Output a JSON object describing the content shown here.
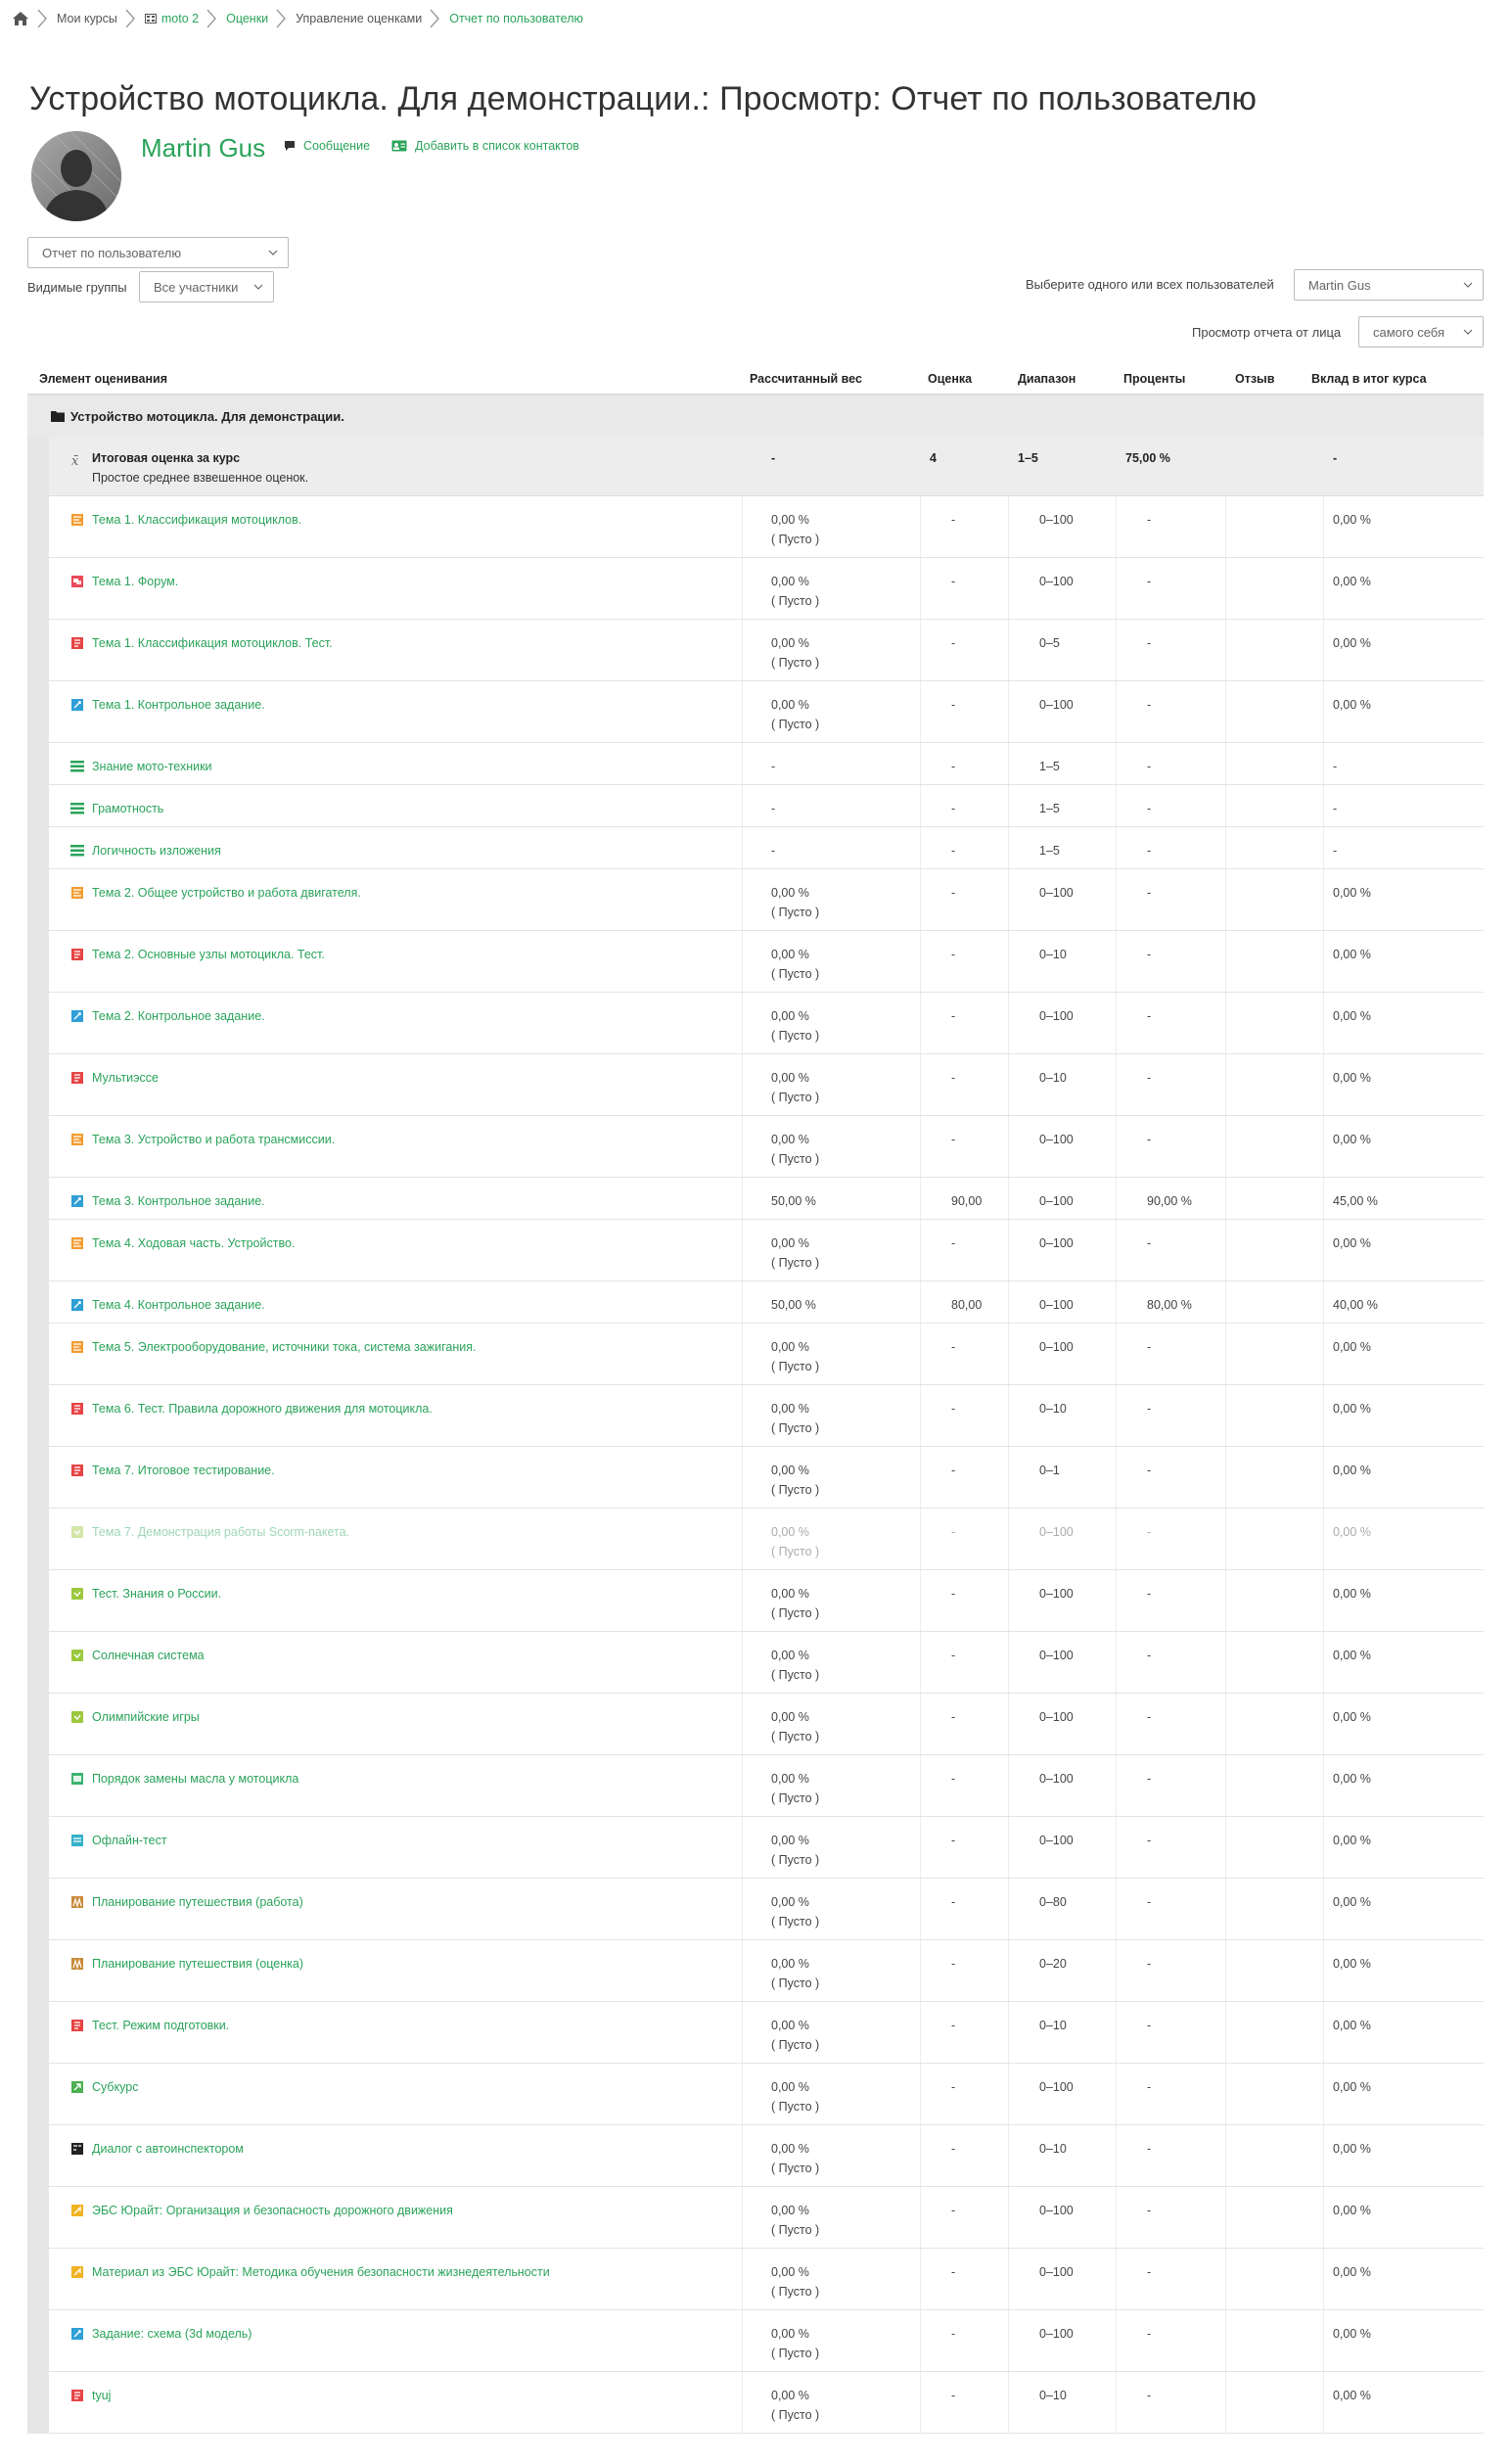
{
  "breadcrumb": [
    "Мои курсы",
    "moto 2",
    "Оценки",
    "Управление оценками",
    "Отчет по пользователю"
  ],
  "page_title": "Устройство мотоцикла. Для демонстрации.: Просмотр: Отчет по пользователю",
  "user": {
    "name": "Martin Gus",
    "message": "Сообщение",
    "add_contact": "Добавить в список контактов"
  },
  "controls": {
    "report_select": "Отчет по пользователю",
    "groups_label": "Видимые группы",
    "groups_select": "Все участники",
    "user_select_label": "Выберите одного или всех пользователей",
    "user_select": "Martin Gus",
    "view_as_label": "Просмотр отчета от лица",
    "view_as_select": "самого себя"
  },
  "table": {
    "headers": [
      "Элемент оценивания",
      "Рассчитанный вес",
      "Оценка",
      "Диапазон",
      "Проценты",
      "Отзыв",
      "Вклад в итог курса"
    ],
    "category": "Устройство мотоцикла. Для демонстрации.",
    "total": {
      "name": "Итоговая оценка за курс",
      "sub": "Простое среднее взвешенное оценок.",
      "weight": "-",
      "grade": "4",
      "range": "1–5",
      "percent": "75,00 %",
      "contrib": "-"
    },
    "rows": [
      {
        "name": "Тема 1. Классификация мотоциклов.",
        "icon": "lesson",
        "w": "0,00 %",
        "w2": "( Пусто )",
        "g": "-",
        "r": "0–100",
        "p": "-",
        "k": "0,00 %"
      },
      {
        "name": "Тема 1. Форум.",
        "icon": "forum",
        "w": "0,00 %",
        "w2": "( Пусто )",
        "g": "-",
        "r": "0–100",
        "p": "-",
        "k": "0,00 %"
      },
      {
        "name": "Тема 1. Классификация мотоциклов. Тест.",
        "icon": "quiz",
        "w": "0,00 %",
        "w2": "( Пусто )",
        "g": "-",
        "r": "0–5",
        "p": "-",
        "k": "0,00 %"
      },
      {
        "name": "Тема 1. Контрольное задание.",
        "icon": "assign",
        "w": "0,00 %",
        "w2": "( Пусто )",
        "g": "-",
        "r": "0–100",
        "p": "-",
        "k": "0,00 %"
      },
      {
        "name": "Знание мото-техники",
        "icon": "manual",
        "w": "-",
        "w2": "",
        "g": "-",
        "r": "1–5",
        "p": "-",
        "k": "-"
      },
      {
        "name": "Грамотность",
        "icon": "manual",
        "w": "-",
        "w2": "",
        "g": "-",
        "r": "1–5",
        "p": "-",
        "k": "-"
      },
      {
        "name": "Логичность изложения",
        "icon": "manual",
        "w": "-",
        "w2": "",
        "g": "-",
        "r": "1–5",
        "p": "-",
        "k": "-"
      },
      {
        "name": "Тема 2. Общее устройство и работа двигателя.",
        "icon": "lesson",
        "w": "0,00 %",
        "w2": "( Пусто )",
        "g": "-",
        "r": "0–100",
        "p": "-",
        "k": "0,00 %"
      },
      {
        "name": "Тема 2. Основные узлы мотоцикла. Тест.",
        "icon": "quiz",
        "w": "0,00 %",
        "w2": "( Пусто )",
        "g": "-",
        "r": "0–10",
        "p": "-",
        "k": "0,00 %"
      },
      {
        "name": "Тема 2. Контрольное задание.",
        "icon": "assign",
        "w": "0,00 %",
        "w2": "( Пусто )",
        "g": "-",
        "r": "0–100",
        "p": "-",
        "k": "0,00 %"
      },
      {
        "name": "Мультиэссе",
        "icon": "quiz",
        "w": "0,00 %",
        "w2": "( Пусто )",
        "g": "-",
        "r": "0–10",
        "p": "-",
        "k": "0,00 %"
      },
      {
        "name": "Тема 3. Устройство и работа трансмиссии.",
        "icon": "lesson",
        "w": "0,00 %",
        "w2": "( Пусто )",
        "g": "-",
        "r": "0–100",
        "p": "-",
        "k": "0,00 %"
      },
      {
        "name": "Тема 3. Контрольное задание.",
        "icon": "assign",
        "w": "50,00 %",
        "w2": "",
        "g": "90,00",
        "r": "0–100",
        "p": "90,00 %",
        "k": "45,00 %"
      },
      {
        "name": "Тема 4. Ходовая часть. Устройство.",
        "icon": "lesson",
        "w": "0,00 %",
        "w2": "( Пусто )",
        "g": "-",
        "r": "0–100",
        "p": "-",
        "k": "0,00 %"
      },
      {
        "name": "Тема 4. Контрольное задание.",
        "icon": "assign",
        "w": "50,00 %",
        "w2": "",
        "g": "80,00",
        "r": "0–100",
        "p": "80,00 %",
        "k": "40,00 %"
      },
      {
        "name": "Тема 5. Электрооборудование, источники тока, система зажигания.",
        "icon": "lesson",
        "w": "0,00 %",
        "w2": "( Пусто )",
        "g": "-",
        "r": "0–100",
        "p": "-",
        "k": "0,00 %"
      },
      {
        "name": "Тема 6. Тест. Правила дорожного движения для мотоцикла.",
        "icon": "quiz",
        "w": "0,00 %",
        "w2": "( Пусто )",
        "g": "-",
        "r": "0–10",
        "p": "-",
        "k": "0,00 %"
      },
      {
        "name": "Тема 7. Итоговое тестирование.",
        "icon": "quiz",
        "w": "0,00 %",
        "w2": "( Пусто )",
        "g": "-",
        "r": "0–1",
        "p": "-",
        "k": "0,00 %"
      },
      {
        "name": "Тема 7. Демонстрация работы Scorm-пакета.",
        "icon": "scorm",
        "w": "0,00 %",
        "w2": "( Пусто )",
        "g": "-",
        "r": "0–100",
        "p": "-",
        "k": "0,00 %",
        "dim": true
      },
      {
        "name": "Тест. Знания о России.",
        "icon": "scorm",
        "w": "0,00 %",
        "w2": "( Пусто )",
        "g": "-",
        "r": "0–100",
        "p": "-",
        "k": "0,00 %"
      },
      {
        "name": "Солнечная система",
        "icon": "scorm",
        "w": "0,00 %",
        "w2": "( Пусто )",
        "g": "-",
        "r": "0–100",
        "p": "-",
        "k": "0,00 %"
      },
      {
        "name": "Олимпийские игры",
        "icon": "scorm",
        "w": "0,00 %",
        "w2": "( Пусто )",
        "g": "-",
        "r": "0–100",
        "p": "-",
        "k": "0,00 %"
      },
      {
        "name": "Порядок замены масла у мотоцикла",
        "icon": "hvp",
        "w": "0,00 %",
        "w2": "( Пусто )",
        "g": "-",
        "r": "0–100",
        "p": "-",
        "k": "0,00 %"
      },
      {
        "name": "Офлайн-тест",
        "icon": "offline",
        "w": "0,00 %",
        "w2": "( Пусто )",
        "g": "-",
        "r": "0–100",
        "p": "-",
        "k": "0,00 %"
      },
      {
        "name": "Планирование путешествия (работа)",
        "icon": "workshop",
        "w": "0,00 %",
        "w2": "( Пусто )",
        "g": "-",
        "r": "0–80",
        "p": "-",
        "k": "0,00 %"
      },
      {
        "name": "Планирование путешествия (оценка)",
        "icon": "workshop",
        "w": "0,00 %",
        "w2": "( Пусто )",
        "g": "-",
        "r": "0–20",
        "p": "-",
        "k": "0,00 %"
      },
      {
        "name": "Тест. Режим подготовки.",
        "icon": "quiz",
        "w": "0,00 %",
        "w2": "( Пусто )",
        "g": "-",
        "r": "0–10",
        "p": "-",
        "k": "0,00 %"
      },
      {
        "name": "Субкурс",
        "icon": "subcourse",
        "w": "0,00 %",
        "w2": "( Пусто )",
        "g": "-",
        "r": "0–100",
        "p": "-",
        "k": "0,00 %"
      },
      {
        "name": "Диалог с автоинспектором",
        "icon": "dialog",
        "w": "0,00 %",
        "w2": "( Пусто )",
        "g": "-",
        "r": "0–10",
        "p": "-",
        "k": "0,00 %"
      },
      {
        "name": "ЭБС Юрайт: Организация и безопасность дорожного движения",
        "icon": "ebs",
        "w": "0,00 %",
        "w2": "( Пусто )",
        "g": "-",
        "r": "0–100",
        "p": "-",
        "k": "0,00 %"
      },
      {
        "name": "Материал из ЭБС Юрайт: Методика обучения безопасности жизнедеятельности",
        "icon": "ebs",
        "w": "0,00 %",
        "w2": "( Пусто )",
        "g": "-",
        "r": "0–100",
        "p": "-",
        "k": "0,00 %"
      },
      {
        "name": "Задание: схема (3d модель)",
        "icon": "assign",
        "w": "0,00 %",
        "w2": "( Пусто )",
        "g": "-",
        "r": "0–100",
        "p": "-",
        "k": "0,00 %"
      },
      {
        "name": "tyuj",
        "icon": "quiz",
        "w": "0,00 %",
        "w2": "( Пусто )",
        "g": "-",
        "r": "0–10",
        "p": "-",
        "k": "0,00 %"
      }
    ]
  },
  "icon_colors": {
    "lesson": "#f39c32",
    "forum": "#e9495a",
    "quiz": "#e64545",
    "assign": "#2f9fd6",
    "manual": "#2aa35a",
    "scorm": "#9bc83e",
    "hvp": "#3cb371",
    "offline": "#35b0c9",
    "workshop": "#c98a3a",
    "subcourse": "#4caf50",
    "dialog": "#222222",
    "ebs": "#f0b323"
  },
  "accent": "#2aa35a"
}
